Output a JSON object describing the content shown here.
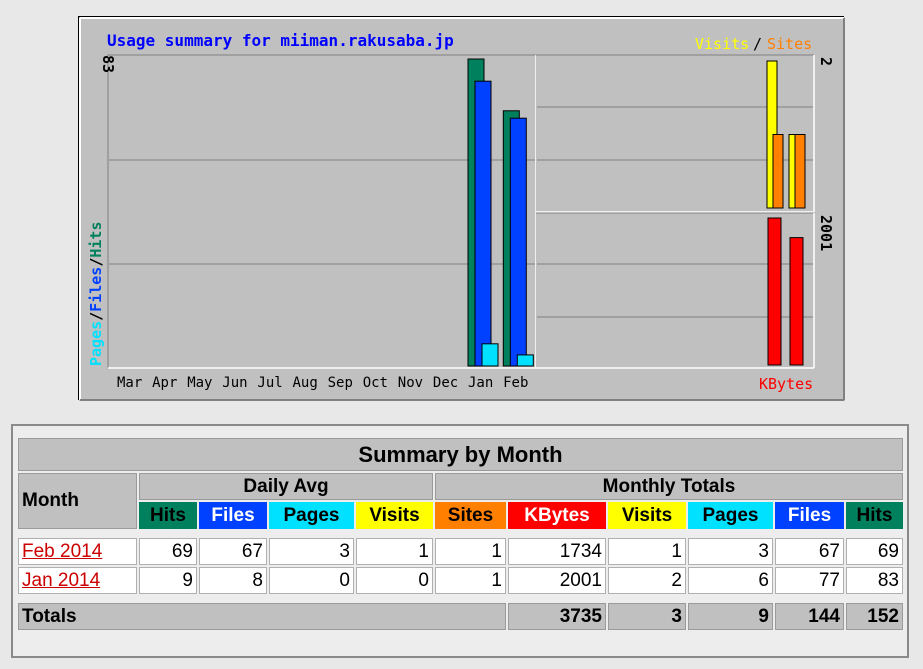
{
  "graph": {
    "title": "Usage summary for miiman.rakusaba.jp",
    "legend_visits": "Visits",
    "legend_sep": "/",
    "legend_sites": "Sites",
    "left_axis_pages": "Pages",
    "left_axis_files": "Files",
    "left_axis_hits": "Hits",
    "left_max": "83",
    "right_top_max": "2",
    "right_bottom_max": "2001",
    "kbytes_label": "KBytes",
    "colors": {
      "hits": "#00805c",
      "files": "#0040ff",
      "pages": "#00e0ff",
      "visits": "#ffff00",
      "sites": "#ff8000",
      "kbytes": "#ff0000",
      "title": "#0000ff"
    }
  },
  "chart_data": {
    "type": "bar",
    "categories": [
      "Mar",
      "Apr",
      "May",
      "Jun",
      "Jul",
      "Aug",
      "Sep",
      "Oct",
      "Nov",
      "Dec",
      "Jan",
      "Feb"
    ],
    "left_ylim": [
      0,
      83
    ],
    "series": [
      {
        "name": "Hits",
        "values": [
          0,
          0,
          0,
          0,
          0,
          0,
          0,
          0,
          0,
          0,
          83,
          69
        ]
      },
      {
        "name": "Files",
        "values": [
          0,
          0,
          0,
          0,
          0,
          0,
          0,
          0,
          0,
          0,
          77,
          67
        ]
      },
      {
        "name": "Pages",
        "values": [
          0,
          0,
          0,
          0,
          0,
          0,
          0,
          0,
          0,
          0,
          6,
          3
        ]
      }
    ],
    "right_months": [
      "Jan",
      "Feb"
    ],
    "right_top": {
      "ylim": [
        0,
        2
      ],
      "series": [
        {
          "name": "Visits",
          "values": [
            2,
            1
          ]
        },
        {
          "name": "Sites",
          "values": [
            1,
            1
          ]
        }
      ]
    },
    "right_bottom": {
      "ylim": [
        0,
        2001
      ],
      "series": [
        {
          "name": "KBytes",
          "values": [
            2001,
            1734
          ]
        }
      ]
    }
  },
  "table": {
    "title": "Summary by Month",
    "month_header": "Month",
    "daily_avg": "Daily Avg",
    "monthly_totals": "Monthly Totals",
    "cols": {
      "hits": "Hits",
      "files": "Files",
      "pages": "Pages",
      "visits": "Visits",
      "sites": "Sites",
      "kbytes": "KBytes"
    },
    "rows": [
      {
        "month": "Feb 2014",
        "d_hits": "69",
        "d_files": "67",
        "d_pages": "3",
        "d_visits": "1",
        "sites": "1",
        "kbytes": "1734",
        "visits": "1",
        "pages": "3",
        "files": "67",
        "hits": "69"
      },
      {
        "month": "Jan 2014",
        "d_hits": "9",
        "d_files": "8",
        "d_pages": "0",
        "d_visits": "0",
        "sites": "1",
        "kbytes": "2001",
        "visits": "2",
        "pages": "6",
        "files": "77",
        "hits": "83"
      }
    ],
    "totals": {
      "label": "Totals",
      "kbytes": "3735",
      "visits": "3",
      "pages": "9",
      "files": "144",
      "hits": "152"
    }
  }
}
